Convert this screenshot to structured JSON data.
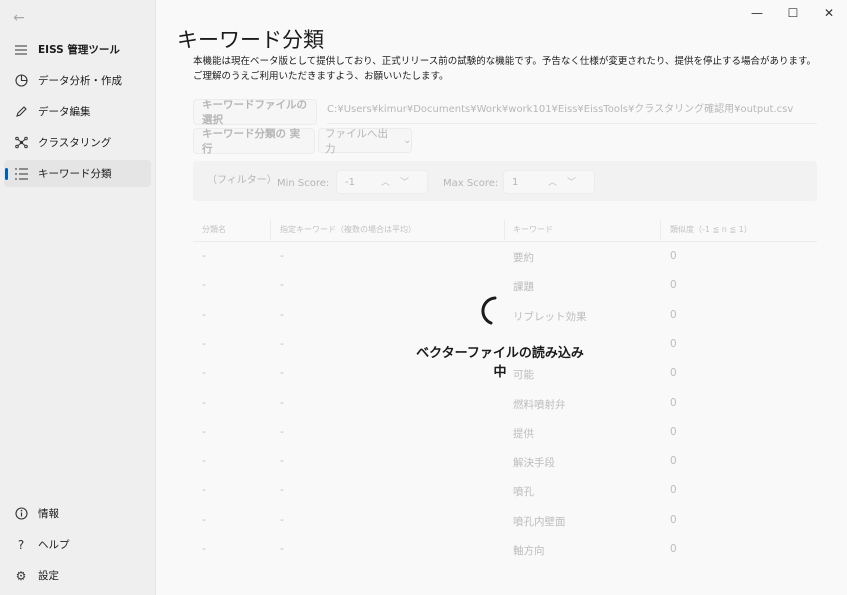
{
  "sidebar": {
    "app_title": "EISS 管理ツール",
    "items": [
      {
        "label": "データ分析・作成",
        "icon": "chart-pie-icon"
      },
      {
        "label": "データ編集",
        "icon": "pencil-icon"
      },
      {
        "label": "クラスタリング",
        "icon": "cluster-icon"
      },
      {
        "label": "キーワード分類",
        "icon": "list-icon"
      }
    ],
    "bottom_items": [
      {
        "label": "情報",
        "icon": "info-icon"
      },
      {
        "label": "ヘルプ",
        "icon": "help-icon"
      },
      {
        "label": "設定",
        "icon": "gear-icon"
      }
    ]
  },
  "page": {
    "title": "キーワード分類",
    "notice": "本機能は現在ベータ版として提供しており、正式リリース前の試験的な機能です。予告なく仕様が変更されたり、提供を停止する場合があります。ご理解のうえご利用いただきますよう、お願いいたします。"
  },
  "toolbar": {
    "select_file_label": "キーワードファイルの選択",
    "file_path": "C:¥Users¥kimur¥Documents¥Work¥work101¥Eiss¥EissTools¥クラスタリング確認用¥output.csv",
    "run_label": "キーワード分類の 実行",
    "export_label": "ファイルへ出力"
  },
  "filter": {
    "label": "（フィルター）",
    "min_label": "Min Score:",
    "min_value": "-1",
    "max_label": "Max Score:",
    "max_value": "1"
  },
  "table": {
    "headers": [
      "分類名",
      "指定キーワード（複数の場合は平均）",
      "キーワード",
      "類似度（-1 ≦ n ≦ 1）"
    ],
    "rows": [
      [
        "-",
        "-",
        "要約",
        "0"
      ],
      [
        "-",
        "-",
        "課題",
        "0"
      ],
      [
        "-",
        "-",
        "リブレット効果",
        "0"
      ],
      [
        "-",
        "-",
        "",
        "0"
      ],
      [
        "-",
        "-",
        "可能",
        "0"
      ],
      [
        "-",
        "-",
        "燃料噴射弁",
        "0"
      ],
      [
        "-",
        "-",
        "提供",
        "0"
      ],
      [
        "-",
        "-",
        "解決手段",
        "0"
      ],
      [
        "-",
        "-",
        "噴孔",
        "0"
      ],
      [
        "-",
        "-",
        "噴孔内壁面",
        "0"
      ],
      [
        "-",
        "-",
        "軸方向",
        "0"
      ]
    ]
  },
  "loading": {
    "text": "ベクターファイルの読み込み中"
  },
  "window_controls": {
    "minimize": "—",
    "maximize": "☐",
    "close": "✕"
  }
}
